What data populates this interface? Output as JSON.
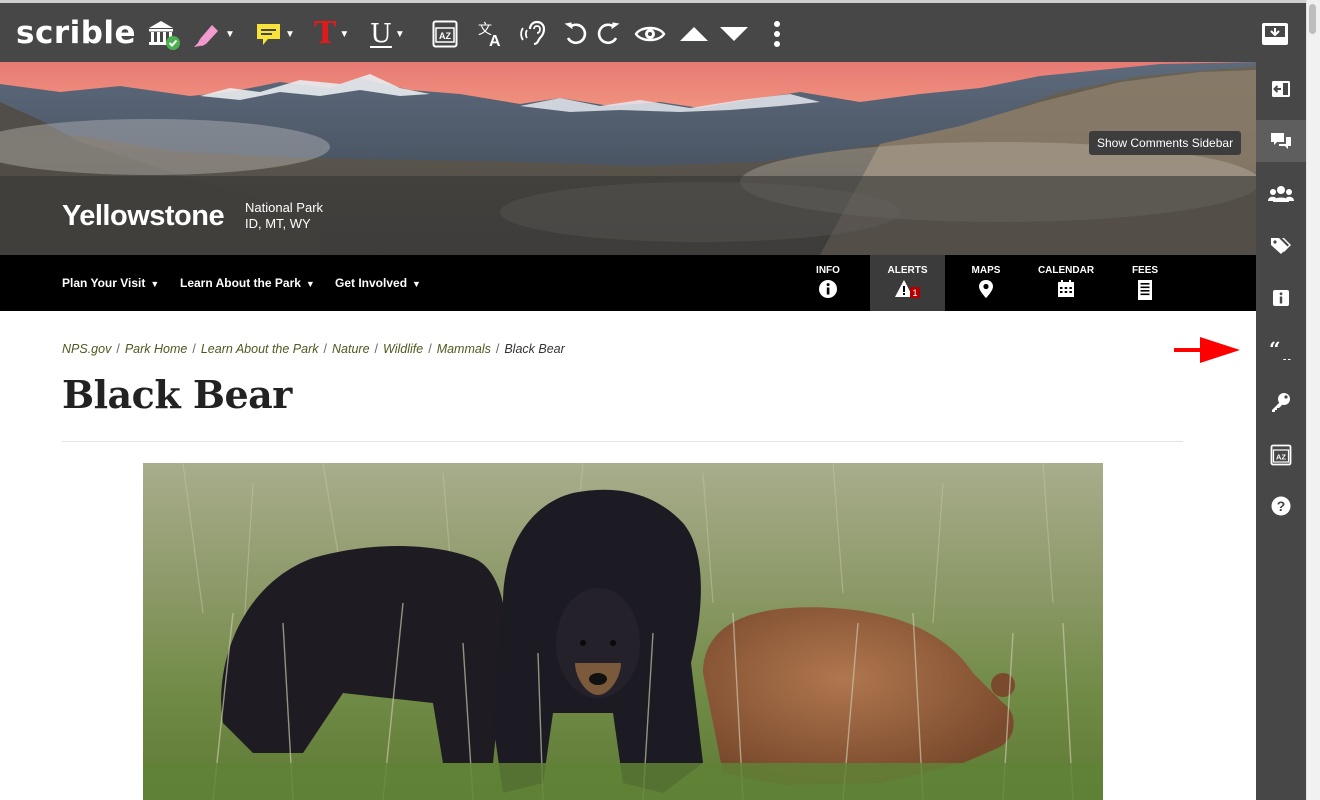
{
  "scrible": {
    "logo": "scrible",
    "toolbar_icons": [
      "library-icon",
      "highlighter-icon",
      "sticky-note-icon",
      "text-color-icon",
      "underline-icon",
      "dictionary-icon",
      "translate-icon",
      "read-aloud-icon",
      "undo-icon",
      "redo-icon",
      "eye-icon",
      "scroll-up-icon",
      "scroll-down-icon",
      "more-icon",
      "save-icon"
    ],
    "text_color_glyph": "T",
    "underline_glyph": "U",
    "dictionary_glyph": "AZ",
    "sidebar_icons": [
      "collapse-sidebar-icon",
      "comments-icon",
      "group-icon",
      "tags-icon",
      "info-icon",
      "citation-quote-icon",
      "key-icon",
      "dictionary-icon",
      "help-icon"
    ],
    "tooltip": "Show Comments Sidebar",
    "colors": {
      "toolbar_bg": "#474747",
      "highlighter": "#f29bcf",
      "sticky_note": "#f7e33a",
      "text_color": "#e11b1b",
      "check_badge": "#4caf50",
      "annotation_arrow": "#ff0000"
    }
  },
  "site": {
    "park_name": "Yellowstone",
    "park_type": "National Park",
    "park_states": "ID, MT, WY",
    "nav": [
      {
        "label": "Plan Your Visit"
      },
      {
        "label": "Learn About the Park"
      },
      {
        "label": "Get Involved"
      }
    ],
    "nav_dropdown_glyph": "▼",
    "utilities": [
      {
        "label": "INFO",
        "icon": "info-circle-icon"
      },
      {
        "label": "ALERTS",
        "icon": "alert-triangle-icon",
        "badge": "1"
      },
      {
        "label": "MAPS",
        "icon": "map-pin-icon"
      },
      {
        "label": "CALENDAR",
        "icon": "calendar-icon"
      },
      {
        "label": "FEES",
        "icon": "receipt-icon"
      }
    ],
    "breadcrumb": {
      "links": [
        "NPS.gov",
        "Park Home",
        "Learn About the Park",
        "Nature",
        "Wildlife",
        "Mammals"
      ],
      "current": "Black Bear",
      "separator": "/"
    },
    "page_title": "Black Bear"
  }
}
